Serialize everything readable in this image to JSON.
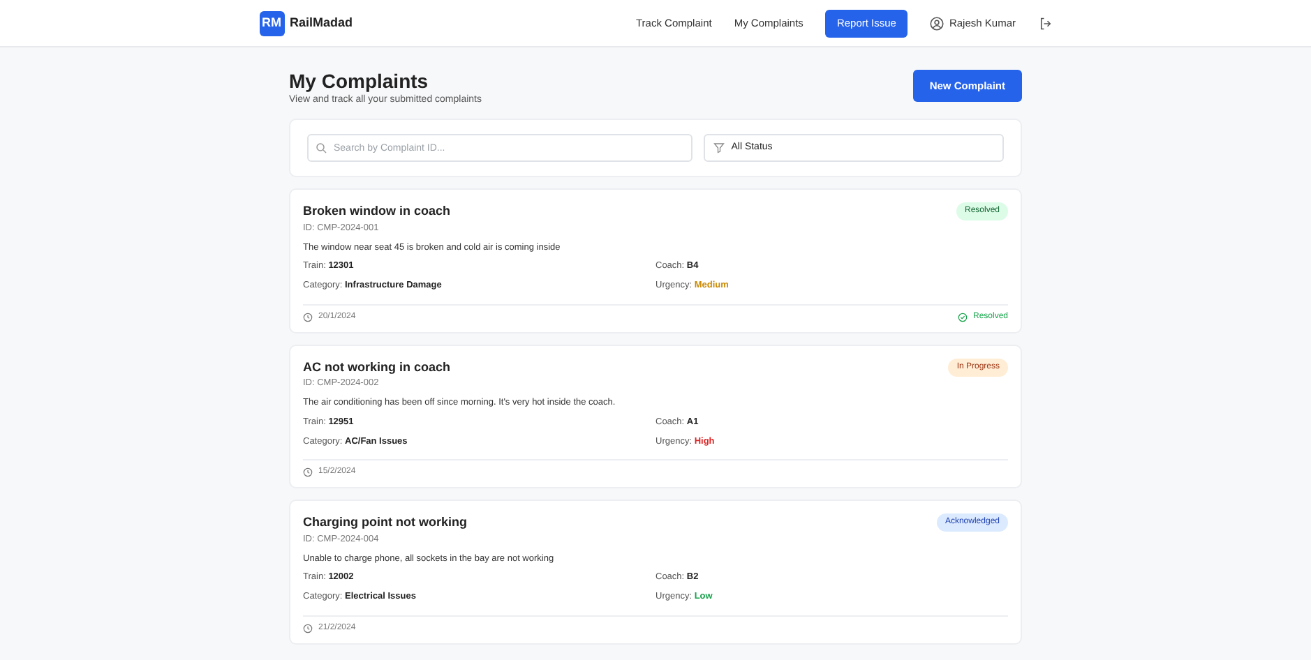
{
  "navbar": {
    "logo": "RM",
    "brand": "RailMadad",
    "links": [
      {
        "label": "Track Complaint",
        "kind": "link"
      },
      {
        "label": "My Complaints",
        "kind": "link"
      },
      {
        "label": "Report Issue",
        "kind": "primary"
      }
    ],
    "user": "Rajesh Kumar"
  },
  "page": {
    "title": "My Complaints",
    "subtitle": "View and track all your submitted complaints",
    "new_button": "New Complaint"
  },
  "filters": {
    "search": {
      "placeholder": "Search by Complaint ID..."
    },
    "status": {
      "value": "All Status"
    }
  },
  "complaints": [
    {
      "title": "Broken window in coach",
      "id": "ID: CMP-2024-001",
      "description": "The window near seat 45 is broken and cold air is coming inside",
      "status": {
        "text": "Resolved",
        "kind": "resolved"
      },
      "train_label": "Train:",
      "train": "12301",
      "coach_label": "Coach:",
      "coach": "B4",
      "category_label": "Category:",
      "category": "Infrastructure Damage",
      "urgency": {
        "label": "Urgency:",
        "value": "Medium",
        "kind": "medium"
      },
      "date": "20/1/2024",
      "footer_status": "Resolved"
    },
    {
      "title": "AC not working in coach",
      "id": "ID: CMP-2024-002",
      "description": "The air conditioning has been off since morning. It's very hot inside the coach.",
      "status": {
        "text": "In Progress",
        "kind": "progress"
      },
      "train_label": "Train:",
      "train": "12951",
      "coach_label": "Coach:",
      "coach": "A1",
      "category_label": "Category:",
      "category": "AC/Fan Issues",
      "urgency": {
        "label": "Urgency:",
        "value": "High",
        "kind": "high"
      },
      "date": "15/2/2024"
    },
    {
      "title": "Charging point not working",
      "id": "ID: CMP-2024-004",
      "description": "Unable to charge phone, all sockets in the bay are not working",
      "status": {
        "text": "Acknowledged",
        "kind": "acknowledged"
      },
      "train_label": "Train:",
      "train": "12002",
      "coach_label": "Coach:",
      "coach": "B2",
      "category_label": "Category:",
      "category": "Electrical Issues",
      "urgency": {
        "label": "Urgency:",
        "value": "Low",
        "kind": "low"
      },
      "date": "21/2/2024"
    }
  ]
}
